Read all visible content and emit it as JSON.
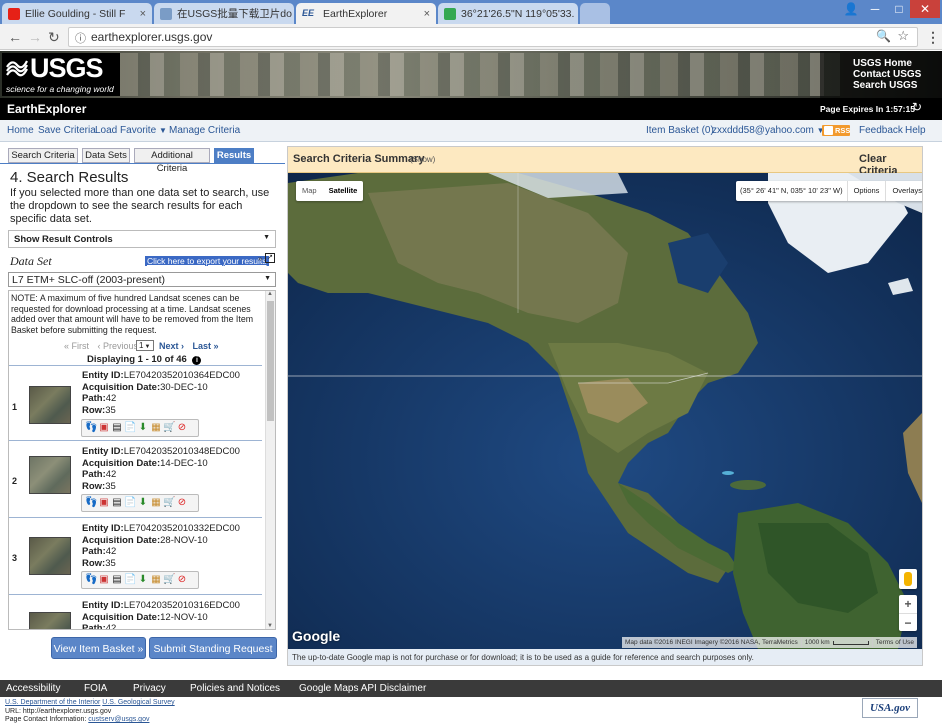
{
  "browser": {
    "tabs": [
      {
        "label": "Ellie Goulding - Still F",
        "icon_color": "#e62117",
        "icon": "youtube-icon"
      },
      {
        "label": "在USGS批量下载卫片do",
        "icon_color": "#7a9cc6",
        "icon": "doc-icon"
      },
      {
        "label": "EarthExplorer",
        "icon_color": "#2b5796",
        "icon": "ee-icon"
      },
      {
        "label": "36°21'26.5\"N 119°05'33.",
        "icon_color": "#34a853",
        "icon": "maps-icon"
      }
    ],
    "url": "earthexplorer.usgs.gov"
  },
  "header": {
    "logo_text": "USGS",
    "logo_tagline": "science for a changing world",
    "links": [
      "USGS Home",
      "Contact USGS",
      "Search USGS"
    ],
    "app_title": "EarthExplorer",
    "page_expires_label": "Page Expires In 1:57:15"
  },
  "menu": {
    "items": [
      "Home",
      "Save Criteria",
      "Load Favorite",
      "Manage Criteria"
    ],
    "item_basket": "Item Basket (0)",
    "user": "zxxddd58@yahoo.com",
    "rss": "RSS",
    "feedback": "Feedback",
    "help": "Help"
  },
  "left": {
    "tabs": [
      "Search Criteria",
      "Data Sets",
      "Additional Criteria",
      "Results"
    ],
    "heading": "4. Search Results",
    "intro": "If you selected more than one data set to search, use the dropdown to see the search results for each specific data set.",
    "result_controls": "Show Result Controls",
    "dataset_label": "Data Set",
    "export_link": "Click here to export your results",
    "dataset_value": "L7 ETM+ SLC-off (2003-present)",
    "note": "NOTE: A maximum of five hundred Landsat scenes can be requested for download processing at a time. Landsat scenes added over that amount will have to be removed from the Item Basket before submitting the request.",
    "pager": {
      "first": "« First",
      "previous": "‹ Previous",
      "page": "1",
      "next": "Next ›",
      "last": "Last »"
    },
    "displaying": "Displaying 1 - 10 of 46",
    "labels": {
      "entity": "Entity ID:",
      "acq": "Acquisition Date:",
      "path": "Path:",
      "row": "Row:"
    },
    "results": [
      {
        "num": "1",
        "entity": "LE70420352010364EDC00",
        "date": "30-DEC-10",
        "path": "42",
        "row": "35"
      },
      {
        "num": "2",
        "entity": "LE70420352010348EDC00",
        "date": "14-DEC-10",
        "path": "42",
        "row": "35"
      },
      {
        "num": "3",
        "entity": "LE70420352010332EDC00",
        "date": "28-NOV-10",
        "path": "42",
        "row": "35"
      },
      {
        "num": "4",
        "entity": "LE70420352010316EDC00",
        "date": "12-NOV-10",
        "path": "42",
        "row": ""
      }
    ],
    "view_basket": "View Item Basket »",
    "standing_request": "Submit Standing Request »"
  },
  "map": {
    "criteria_title": "Search Criteria Summary",
    "criteria_show": "(Show)",
    "clear_criteria": "Clear Criteria",
    "map_btn": "Map",
    "satellite_btn": "Satellite",
    "coords": "(35° 26' 41\" N, 035° 10' 23\" W)",
    "options": "Options",
    "overlays": "Overlays",
    "google": "Google",
    "attribution": "Map data ©2016 INEGI Imagery ©2016 NASA, TerraMetrics",
    "scale": "1000 km",
    "terms": "Terms of Use",
    "note": "The up-to-date Google map is not for purchase or for download; it is to be used as a guide for reference and search purposes only."
  },
  "footer": {
    "links": [
      "Accessibility",
      "FOIA",
      "Privacy",
      "Policies and Notices",
      "Google Maps API Disclaimer"
    ],
    "dept": "U.S. Department of the Interior",
    "survey": "U.S. Geological Survey",
    "url_line": "URL: http://earthexplorer.usgs.gov",
    "contact": "Page Contact Information:",
    "contact_email": "custserv@usgs.gov",
    "usagov": "USA.gov"
  }
}
